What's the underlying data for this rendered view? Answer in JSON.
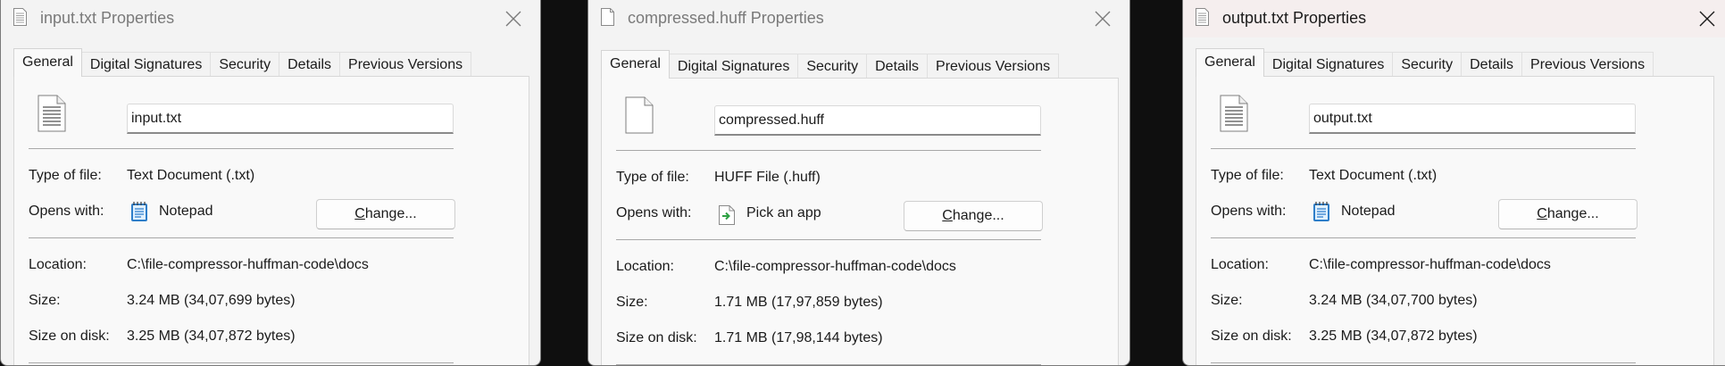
{
  "dialogs": [
    {
      "title": "input.txt Properties",
      "icon": "text-document-icon",
      "tabs": [
        "General",
        "Digital Signatures",
        "Security",
        "Details",
        "Previous Versions"
      ],
      "file_name": "input.txt",
      "type_label": "Type of file:",
      "type_value": "Text Document (.txt)",
      "opens_label": "Opens with:",
      "opens_app": "Notepad",
      "opens_icon": "notepad-icon",
      "change_prefix": "C",
      "change_rest": "hange...",
      "location_label": "Location:",
      "location_value": "C:\\file-compressor-huffman-code\\docs",
      "size_label": "Size:",
      "size_value": "3.24 MB (34,07,699 bytes)",
      "size_on_disk_label": "Size on disk:",
      "size_on_disk_value": "3.25 MB (34,07,872 bytes)"
    },
    {
      "title": "compressed.huff Properties",
      "icon": "blank-document-icon",
      "tabs": [
        "General",
        "Digital Signatures",
        "Security",
        "Details",
        "Previous Versions"
      ],
      "file_name": "compressed.huff",
      "type_label": "Type of file:",
      "type_value": "HUFF File (.huff)",
      "opens_label": "Opens with:",
      "opens_app": "Pick an app",
      "opens_icon": "pick-an-app-icon",
      "change_prefix": "C",
      "change_rest": "hange...",
      "location_label": "Location:",
      "location_value": "C:\\file-compressor-huffman-code\\docs",
      "size_label": "Size:",
      "size_value": "1.71 MB (17,97,859 bytes)",
      "size_on_disk_label": "Size on disk:",
      "size_on_disk_value": "1.71 MB (17,98,144 bytes)"
    },
    {
      "title": "output.txt Properties",
      "icon": "text-document-icon",
      "tabs": [
        "General",
        "Digital Signatures",
        "Security",
        "Details",
        "Previous Versions"
      ],
      "file_name": "output.txt",
      "type_label": "Type of file:",
      "type_value": "Text Document (.txt)",
      "opens_label": "Opens with:",
      "opens_app": "Notepad",
      "opens_icon": "notepad-icon",
      "change_prefix": "C",
      "change_rest": "hange...",
      "location_label": "Location:",
      "location_value": "C:\\file-compressor-huffman-code\\docs",
      "size_label": "Size:",
      "size_value": "3.24 MB (34,07,700 bytes)",
      "size_on_disk_label": "Size on disk:",
      "size_on_disk_value": "3.25 MB (34,07,872 bytes)"
    }
  ],
  "colors": {
    "desktop": "#0f0f0f",
    "dialog_inactive": "#f3f3f3",
    "dialog_active": "#f5eeee",
    "title_inactive": "#7a7a7a",
    "title_active": "#1b1b1b",
    "panel": "#f9f9f9"
  }
}
